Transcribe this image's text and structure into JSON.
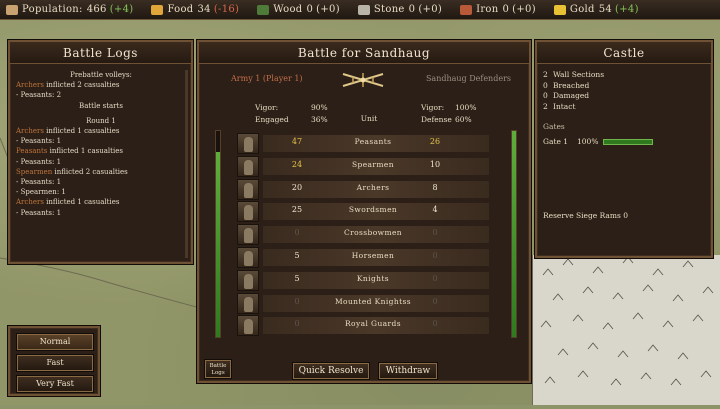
{
  "resources": [
    {
      "label": "Population:",
      "value": "466",
      "delta": "(+4)",
      "delta_type": "pos",
      "icon": "population-icon",
      "color": "#c9a272"
    },
    {
      "label": "Food",
      "value": "34",
      "delta": "(-16)",
      "delta_type": "neg",
      "icon": "food-icon",
      "color": "#e0a63a"
    },
    {
      "label": "Wood",
      "value": "0",
      "delta": "(+0)",
      "delta_type": "none",
      "icon": "wood-icon",
      "color": "#4e7a3a"
    },
    {
      "label": "Stone",
      "value": "0",
      "delta": "(+0)",
      "delta_type": "none",
      "icon": "stone-icon",
      "color": "#b8b4a8"
    },
    {
      "label": "Iron",
      "value": "0",
      "delta": "(+0)",
      "delta_type": "none",
      "icon": "iron-icon",
      "color": "#b85a3a"
    },
    {
      "label": "Gold",
      "value": "54",
      "delta": "(+4)",
      "delta_type": "pos",
      "icon": "gold-icon",
      "color": "#e8c234"
    }
  ],
  "logs": {
    "title": "Battle Logs",
    "lines": [
      {
        "text": "Prebattle volleys:",
        "center": true
      },
      {
        "hl": "Archers",
        "text": " inflicted 2 casualties"
      },
      {
        "text": "- Peasants: 2"
      },
      {
        "text": "Battle starts",
        "center": true
      },
      {
        "spacer": true
      },
      {
        "text": "Round 1",
        "center": true
      },
      {
        "hl": "Archers",
        "text": " inflicted 1 casualties"
      },
      {
        "text": "- Peasants: 1"
      },
      {
        "hl": "Peasants",
        "text": " inflicted 1 casualties"
      },
      {
        "text": "- Peasants: 1"
      },
      {
        "hl": "Spearmen",
        "text": " inflicted 2 casualties"
      },
      {
        "text": "- Peasants: 1"
      },
      {
        "text": "- Spearmen: 1"
      },
      {
        "hl": "Archers",
        "text": " inflicted 1 casualties"
      },
      {
        "text": "- Peasants: 1"
      }
    ]
  },
  "battle": {
    "title": "Battle for Sandhaug",
    "army_left": "Army 1 (Player 1)",
    "army_right": "Sandhaug Defenders",
    "left_stats": {
      "vigor_label": "Vigor:",
      "vigor": "90%",
      "engaged_label": "Engaged",
      "engaged": "36%"
    },
    "right_stats": {
      "vigor_label": "Vigor:",
      "vigor": "100%",
      "defense_label": "Defense",
      "defense": "60%"
    },
    "unit_header": "Unit",
    "units": [
      {
        "name": "Peasants",
        "left": "47",
        "right": "26",
        "left_color": "yellow",
        "right_color": "yellow"
      },
      {
        "name": "Spearmen",
        "left": "24",
        "right": "10",
        "left_color": "yellow",
        "right_color": "white"
      },
      {
        "name": "Archers",
        "left": "20",
        "right": "8",
        "left_color": "white",
        "right_color": "white"
      },
      {
        "name": "Swordsmen",
        "left": "25",
        "right": "4",
        "left_color": "white",
        "right_color": "white"
      },
      {
        "name": "Crossbowmen",
        "left": "0",
        "right": "0",
        "left_color": "dim",
        "right_color": "dim"
      },
      {
        "name": "Horsemen",
        "left": "5",
        "right": "0",
        "left_color": "white",
        "right_color": "dim"
      },
      {
        "name": "Knights",
        "left": "5",
        "right": "0",
        "left_color": "white",
        "right_color": "dim"
      },
      {
        "name": "Mounted Knightss",
        "left": "0",
        "right": "0",
        "left_color": "dim",
        "right_color": "dim"
      },
      {
        "name": "Royal Guards",
        "left": "0",
        "right": "0",
        "left_color": "dim",
        "right_color": "dim"
      }
    ],
    "left_health_fraction": 0.9,
    "right_health_fraction": 1.0,
    "logs_button": "Battle Logs",
    "quick_resolve": "Quick Resolve",
    "withdraw": "Withdraw"
  },
  "castle": {
    "title": "Castle",
    "walls": [
      {
        "count": "2",
        "label": "Wall Sections"
      },
      {
        "count": "0",
        "label": "Breached"
      },
      {
        "count": "0",
        "label": "Damaged"
      },
      {
        "count": "2",
        "label": "Intact"
      }
    ],
    "gates_label": "Gates",
    "gate_name": "Gate 1",
    "gate_health": "100%",
    "gate_fraction": 1.0,
    "reserve": "Reserve Siege Rams 0"
  },
  "speed": {
    "options": [
      "Normal",
      "Fast",
      "Very Fast"
    ],
    "selected": "Normal"
  }
}
